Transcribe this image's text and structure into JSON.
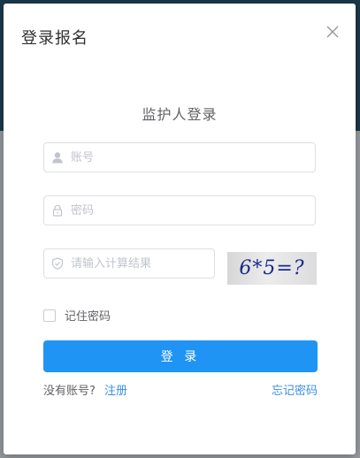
{
  "dialog": {
    "title": "登录报名",
    "close_icon": "close-icon"
  },
  "form": {
    "title": "监护人登录",
    "account": {
      "placeholder": "账号",
      "value": "",
      "icon": "user-icon"
    },
    "password": {
      "placeholder": "密码",
      "value": "",
      "icon": "lock-icon"
    },
    "captcha": {
      "placeholder": "请输入计算结果",
      "value": "",
      "icon": "shield-icon",
      "image_text": "6*5=?"
    },
    "remember_label": "记住密码",
    "remember_checked": false,
    "login_label": "登 录",
    "no_account_text": "没有账号?",
    "register_label": "注册",
    "forgot_label": "忘记密码"
  },
  "colors": {
    "primary": "#1f94f5",
    "link": "#3a8ee6",
    "text": "#606266",
    "placeholder": "#c0c4cc",
    "border": "#dcdfe6"
  }
}
